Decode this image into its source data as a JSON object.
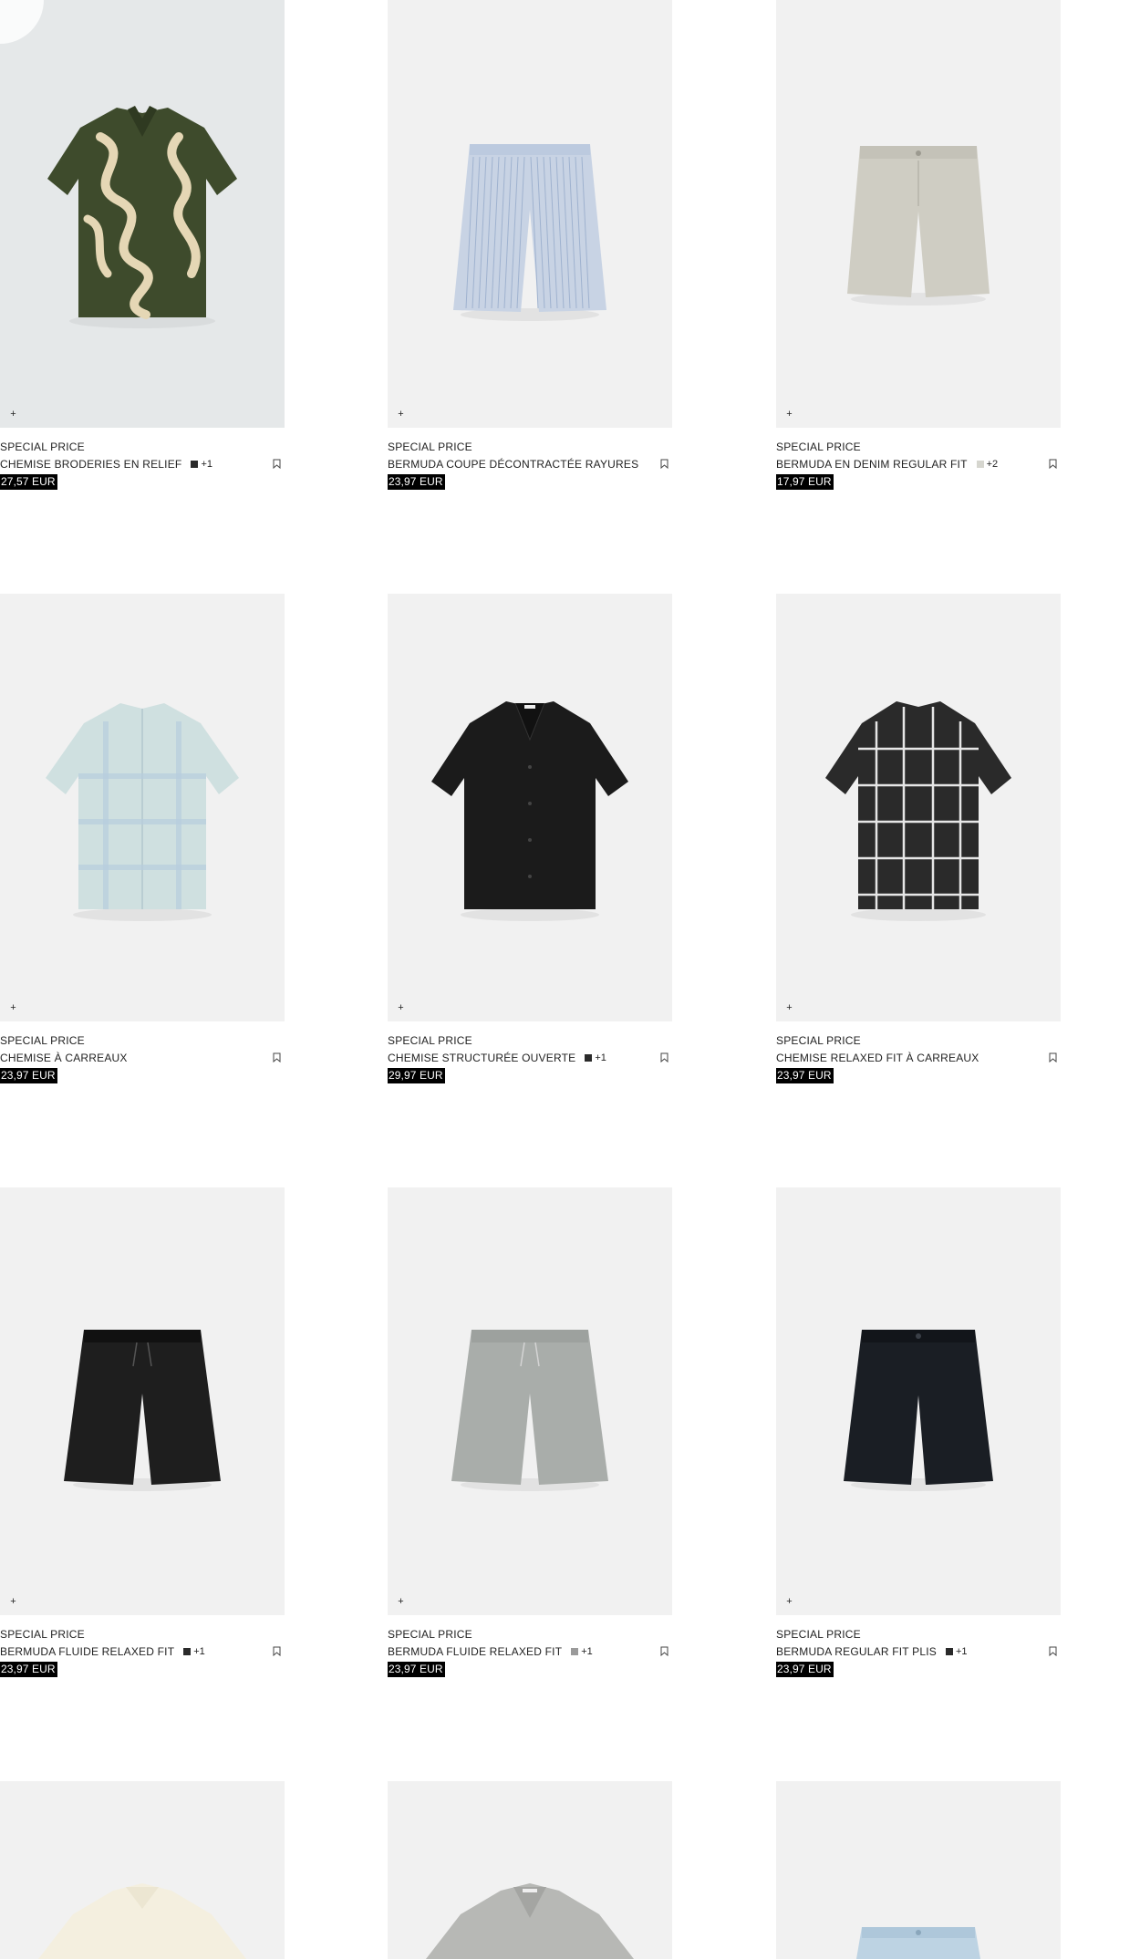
{
  "products": [
    {
      "tag": "SPECIAL PRICE",
      "name": "CHEMISE BRODERIES EN RELIEF",
      "colors_more": "+1",
      "swatch": "#2a2a2a",
      "price": "27,57 EUR",
      "image": "green-embroidered-shirt",
      "bg": "tinted"
    },
    {
      "tag": "SPECIAL PRICE",
      "name": "BERMUDA COUPE DÉCONTRACTÉE RAYURES",
      "colors_more": "",
      "swatch": "",
      "price": "23,97 EUR",
      "image": "blue-striped-shorts",
      "bg": "plain"
    },
    {
      "tag": "SPECIAL PRICE",
      "name": "BERMUDA EN DENIM REGULAR FIT",
      "colors_more": "+2",
      "swatch": "#d6d6cf",
      "price": "17,97 EUR",
      "image": "beige-denim-shorts",
      "bg": "plain"
    },
    {
      "tag": "SPECIAL PRICE",
      "name": "CHEMISE À CARREAUX",
      "colors_more": "",
      "swatch": "",
      "price": "23,97 EUR",
      "image": "light-blue-check-shirt",
      "bg": "plain"
    },
    {
      "tag": "SPECIAL PRICE",
      "name": "CHEMISE STRUCTURÉE OUVERTE",
      "colors_more": "+1",
      "swatch": "#2a2a2a",
      "price": "29,97 EUR",
      "image": "black-textured-shirt",
      "bg": "plain"
    },
    {
      "tag": "SPECIAL PRICE",
      "name": "CHEMISE RELAXED FIT À CARREAUX",
      "colors_more": "",
      "swatch": "",
      "price": "23,97 EUR",
      "image": "black-white-check-shirt",
      "bg": "plain"
    },
    {
      "tag": "SPECIAL PRICE",
      "name": "BERMUDA FLUIDE RELAXED FIT",
      "colors_more": "+1",
      "swatch": "#2a2a2a",
      "price": "23,97 EUR",
      "image": "black-fluid-shorts",
      "bg": "plain"
    },
    {
      "tag": "SPECIAL PRICE",
      "name": "BERMUDA FLUIDE RELAXED FIT",
      "colors_more": "+1",
      "swatch": "#9a9a9a",
      "price": "23,97 EUR",
      "image": "grey-fluid-shorts",
      "bg": "plain"
    },
    {
      "tag": "SPECIAL PRICE",
      "name": "BERMUDA REGULAR FIT PLIS",
      "colors_more": "+1",
      "swatch": "#2a2a2a",
      "price": "23,97 EUR",
      "image": "navy-pleated-shorts",
      "bg": "plain"
    },
    {
      "image": "cream-shirt-partial",
      "bg": "plain"
    },
    {
      "image": "grey-shirt-partial",
      "bg": "plain"
    },
    {
      "image": "light-denim-shorts-partial",
      "bg": "plain"
    }
  ],
  "icons": {
    "add": "plus-icon",
    "save": "bookmark-icon"
  }
}
